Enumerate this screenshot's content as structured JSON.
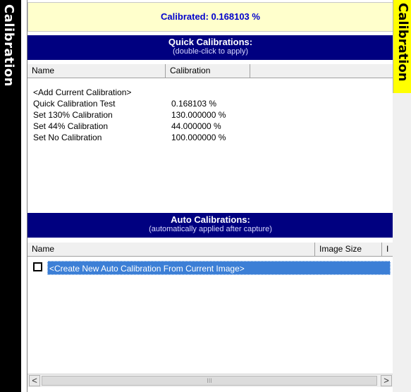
{
  "left_tab": {
    "label": "Calibration"
  },
  "right_tab": {
    "label": "Calibration"
  },
  "status": {
    "text": "Calibrated: 0.168103 %"
  },
  "quick": {
    "title": "Quick Calibrations:",
    "subtitle": "(double-click to apply)",
    "columns": [
      "Name",
      "Calibration"
    ],
    "rows": [
      {
        "name": "<Add Current Calibration>",
        "value": ""
      },
      {
        "name": "Quick Calibration Test",
        "value": "0.168103 %"
      },
      {
        "name": "Set 130% Calibration",
        "value": "130.000000 %"
      },
      {
        "name": "Set 44% Calibration",
        "value": "44.000000 %"
      },
      {
        "name": "Set No Calibration",
        "value": "100.000000 %"
      }
    ]
  },
  "auto": {
    "title": "Auto Calibrations:",
    "subtitle": "(automatically applied after capture)",
    "columns": [
      "Name",
      "Image Size",
      "I"
    ],
    "rows": [
      {
        "name": "<Create New Auto Calibration From Current Image>",
        "checked": false
      }
    ]
  },
  "scrollbar": {
    "left_arrow": "<",
    "right_arrow": ">",
    "thumb_grip": "III"
  }
}
